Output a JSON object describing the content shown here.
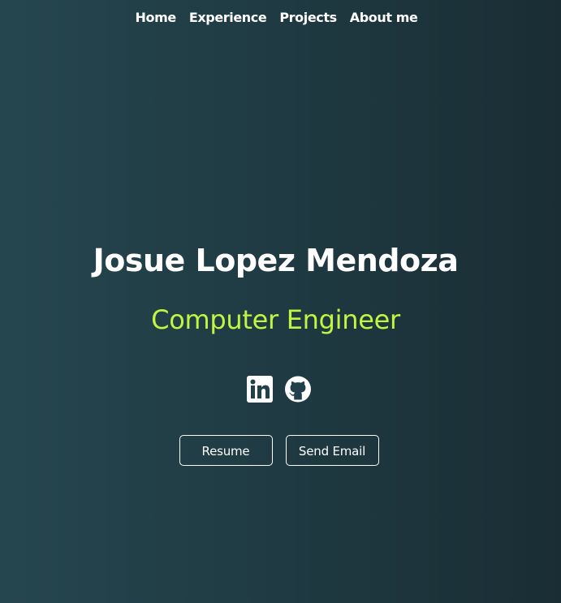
{
  "nav": {
    "items": [
      {
        "label": "Home"
      },
      {
        "label": "Experience"
      },
      {
        "label": "Projects"
      },
      {
        "label": "About me"
      }
    ]
  },
  "hero": {
    "name": "Josue Lopez Mendoza",
    "role": "Computer Engineer"
  },
  "social": {
    "links": [
      {
        "icon": "linkedin-icon"
      },
      {
        "icon": "github-icon"
      }
    ]
  },
  "actions": {
    "resume_label": "Resume",
    "email_label": "Send Email"
  },
  "colors": {
    "background_start": "#26464f",
    "background_end": "#1a2d34",
    "accent": "#c0f542",
    "text": "#ffffff"
  }
}
